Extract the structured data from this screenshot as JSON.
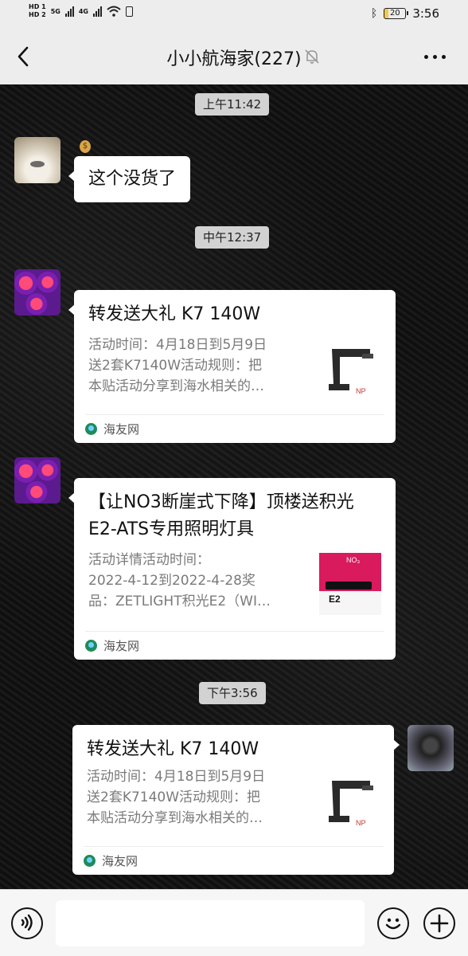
{
  "status_bar": {
    "hd1": "HD 1",
    "hd2": "HD 2",
    "net1": "5G",
    "net2": "4G",
    "battery": "20",
    "time": "3:56"
  },
  "header": {
    "title": "小小航海家(227)",
    "back_icon": "chevron-left-icon",
    "mute_icon": "bell-mute-icon",
    "more_icon": "more-dots-icon"
  },
  "messages": [
    {
      "type": "timestamp",
      "text": "上午11:42"
    },
    {
      "type": "text",
      "side": "left",
      "avatar": "dog",
      "text": "这个没货了"
    },
    {
      "type": "timestamp",
      "text": "中午12:37"
    },
    {
      "type": "card",
      "side": "left",
      "avatar": "coral",
      "title": "转发送大礼 K7 140W",
      "desc": [
        "活动时间：4月18日到5月9日",
        "送2套K7140W活动规则：把",
        "本贴活动分享到海水相关的…"
      ],
      "thumb": "lamp",
      "source": "海友网"
    },
    {
      "type": "card",
      "side": "left",
      "avatar": "coral",
      "title": "【让NO3断崖式下降】顶楼送积光E2-ATS专用照明灯具",
      "desc": [
        "活动详情活动时间：",
        "2022-4-12到2022-4-28奖",
        "品：ZETLIGHT积光E2（WI…"
      ],
      "thumb": "e2",
      "source": "海友网"
    },
    {
      "type": "timestamp",
      "text": "下午3:56"
    },
    {
      "type": "card",
      "side": "right",
      "avatar": "moto",
      "title": "转发送大礼 K7 140W",
      "desc": [
        "活动时间：4月18日到5月9日",
        "送2套K7140W活动规则：把",
        "本贴活动分享到海水相关的…"
      ],
      "thumb": "lamp",
      "source": "海友网"
    }
  ],
  "input_bar": {
    "voice_icon": "voice-icon",
    "emoji_icon": "emoji-icon",
    "plus_icon": "plus-icon",
    "input_value": ""
  }
}
